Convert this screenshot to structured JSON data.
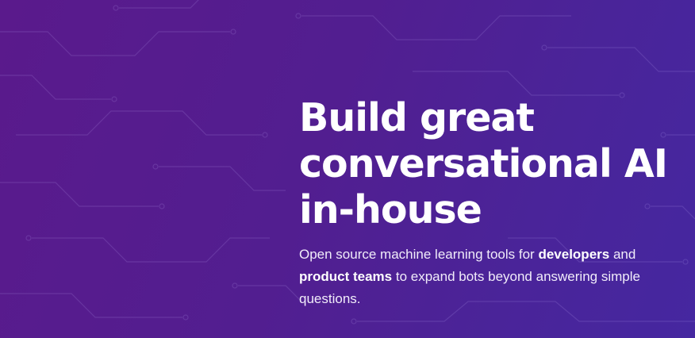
{
  "hero": {
    "headline": {
      "line1": "Build great",
      "line2": "conversational AI",
      "line3": "in-house"
    },
    "subtext": {
      "part1": "Open source machine learning tools for ",
      "bold1": "developers",
      "part2": " and ",
      "bold2": "product teams",
      "part3": " to expand bots beyond answering simple questions."
    }
  },
  "colors": {
    "gradient_left": "#5a1a8c",
    "gradient_right": "#4527a0",
    "text": "#ffffff"
  }
}
